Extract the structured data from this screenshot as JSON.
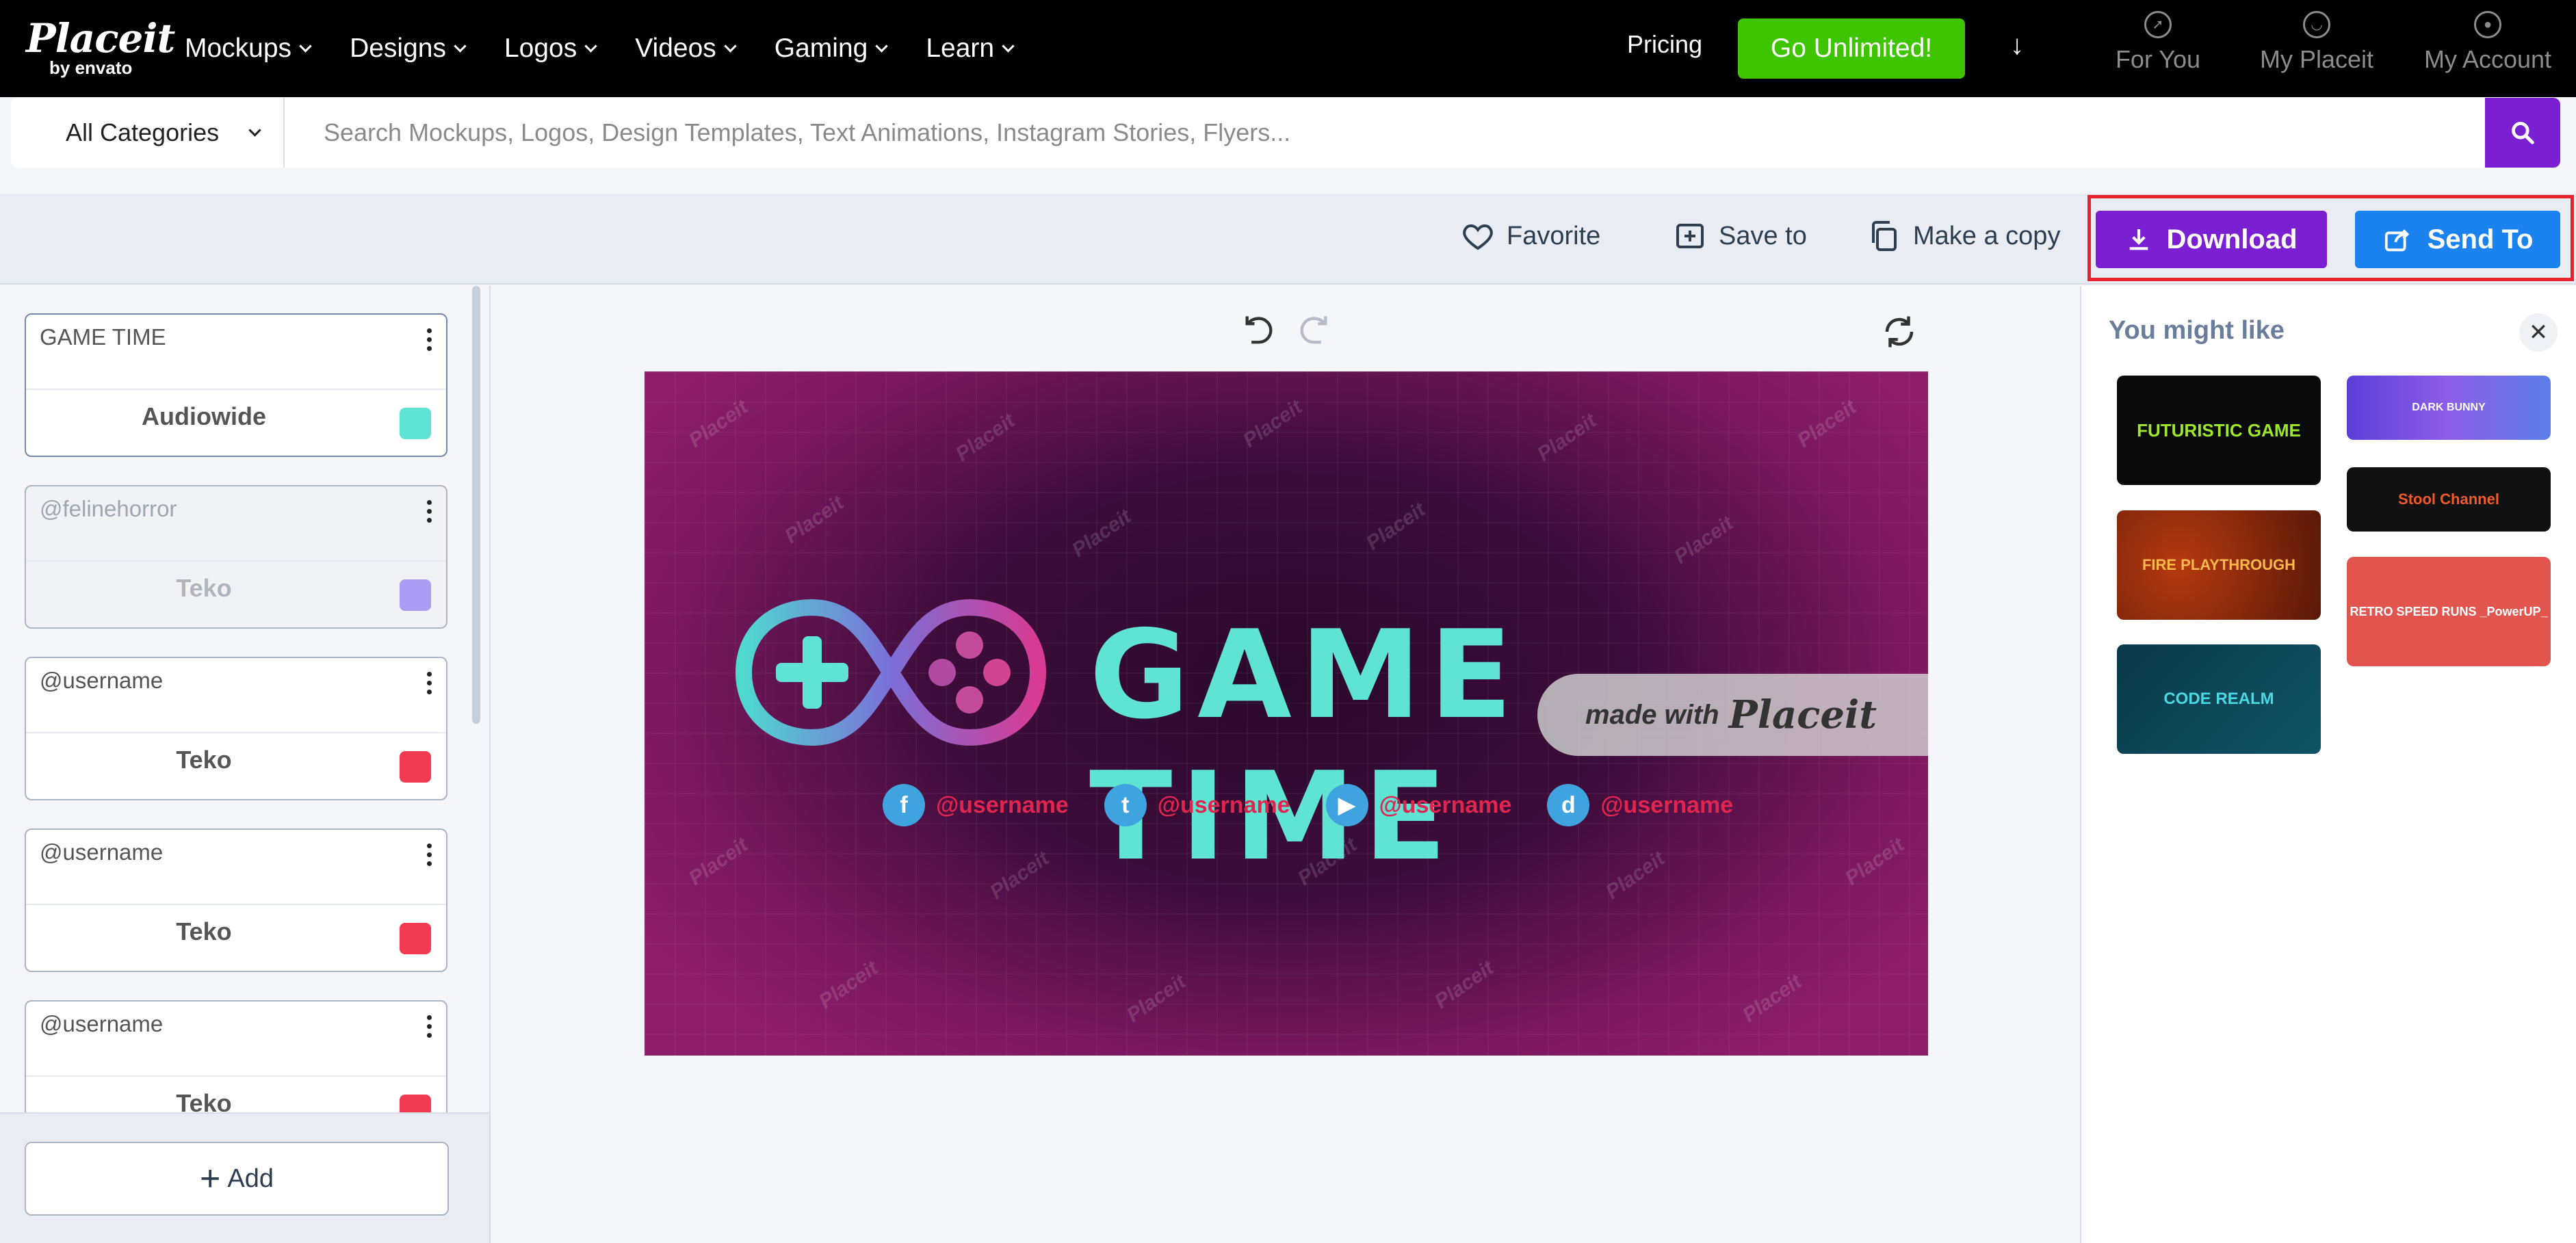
{
  "nav": {
    "logo_main": "Placeit",
    "logo_sub": "by envato",
    "menu": [
      {
        "label": "Mockups"
      },
      {
        "label": "Designs"
      },
      {
        "label": "Logos"
      },
      {
        "label": "Videos"
      },
      {
        "label": "Gaming"
      },
      {
        "label": "Learn"
      }
    ],
    "pricing": "Pricing",
    "cta": "Go Unlimited!",
    "for_you": "For You",
    "my_placeit": "My Placeit",
    "my_account": "My Account"
  },
  "search": {
    "category": "All Categories",
    "placeholder": "Search Mockups, Logos, Design Templates, Text Animations, Instagram Stories, Flyers..."
  },
  "toolbar": {
    "favorite": "Favorite",
    "save_to": "Save to",
    "make_copy": "Make a copy",
    "download": "Download",
    "send_to": "Send To"
  },
  "layers": [
    {
      "text": "GAME TIME",
      "font": "Audiowide",
      "color": "#5fe3d2"
    },
    {
      "text": "@felinehorror",
      "font": "Teko",
      "color": "#a99cf2"
    },
    {
      "text": "@username",
      "font": "Teko",
      "color": "#f23a50"
    },
    {
      "text": "@username",
      "font": "Teko",
      "color": "#f23a50"
    },
    {
      "text": "@username",
      "font": "Teko",
      "color": "#f23a50"
    }
  ],
  "add_label": "Add",
  "banner": {
    "title": "GAME TIME",
    "watermark": "Placeit",
    "made_with": "made with",
    "made_brand": "Placeit",
    "socials": [
      {
        "icon": "f",
        "handle": "@username"
      },
      {
        "icon": "t",
        "handle": "@username"
      },
      {
        "icon": "▶",
        "handle": "@username"
      },
      {
        "icon": "d",
        "handle": "@username"
      }
    ]
  },
  "suggestions": {
    "title": "You might like",
    "items": [
      {
        "label": "FUTURISTIC GAME"
      },
      {
        "label": "DARK BUNNY"
      },
      {
        "label": "Stool Channel"
      },
      {
        "label": "FIRE PLAYTHROUGH"
      },
      {
        "label": "RETRO SPEED RUNS _PowerUP_"
      },
      {
        "label": "CODE REALM"
      }
    ]
  },
  "colors": {
    "download": "#7a1fd1",
    "send_to": "#1a83f0",
    "cta": "#3fc400",
    "highlight": "#e6232f"
  }
}
